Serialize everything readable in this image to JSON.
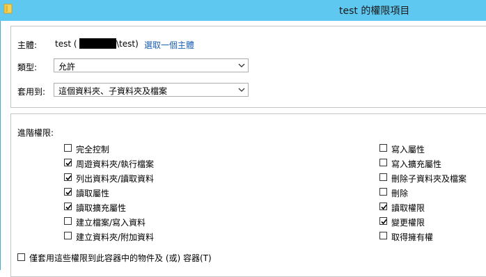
{
  "window": {
    "title": "test 的權限項目",
    "icon": "folder-icon"
  },
  "principal": {
    "label": "主體:",
    "value_prefix": "test (",
    "value_suffix": "\\test)",
    "select_link": "選取一個主體"
  },
  "type": {
    "label": "類型:",
    "value": "允許"
  },
  "applies_to": {
    "label": "套用到:",
    "value": "這個資料夾、子資料夾及檔案"
  },
  "advanced": {
    "label": "進階權限:",
    "left": [
      {
        "label": "完全控制",
        "checked": false
      },
      {
        "label": "周遊資料夾/執行檔案",
        "checked": true
      },
      {
        "label": "列出資料夾/讀取資料",
        "checked": true
      },
      {
        "label": "讀取屬性",
        "checked": true
      },
      {
        "label": "讀取擴充屬性",
        "checked": true
      },
      {
        "label": "建立檔案/寫入資料",
        "checked": false
      },
      {
        "label": "建立資料夾/附加資料",
        "checked": false
      }
    ],
    "right": [
      {
        "label": "寫入屬性",
        "checked": false
      },
      {
        "label": "寫入擴充屬性",
        "checked": false
      },
      {
        "label": "刪除子資料夾及檔案",
        "checked": false
      },
      {
        "label": "刪除",
        "checked": false
      },
      {
        "label": "讀取權限",
        "checked": true
      },
      {
        "label": "變更權限",
        "checked": true
      },
      {
        "label": "取得擁有權",
        "checked": false
      }
    ]
  },
  "apply_container": {
    "label": "僅套用這些權限到此容器中的物件及 (或) 容器(T)",
    "checked": false
  },
  "colors": {
    "titlebar": "#5ec8f0",
    "link": "#1a5fb4"
  }
}
